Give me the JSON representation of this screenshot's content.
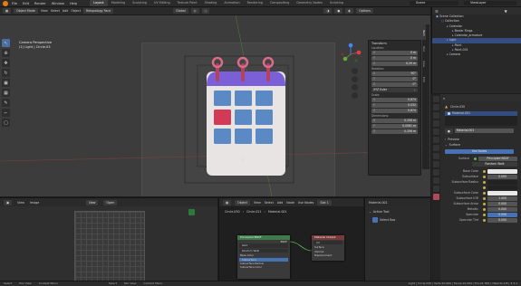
{
  "topbar": {
    "menus": [
      "File",
      "Edit",
      "Render",
      "Window",
      "Help"
    ],
    "tabs": [
      "Layout",
      "Modeling",
      "Sculpting",
      "UV Editing",
      "Texture Paint",
      "Shading",
      "Animation",
      "Rendering",
      "Compositing",
      "Geometry Nodes",
      "Scripting"
    ],
    "active_tab": "Layout",
    "scene": "Scene",
    "view_layer": "ViewLayer"
  },
  "viewport_header": {
    "mode": "Object Mode",
    "menus": [
      "View",
      "Select",
      "Add",
      "Object"
    ],
    "orientation": "Global",
    "transform_pivot": "Retopology Face",
    "options": "Options"
  },
  "viewport_info": {
    "line1": "Camera Perspective",
    "line2": "(1) Light | Circle.03"
  },
  "npanel": {
    "title": "Transform",
    "location_label": "Location:",
    "location": [
      {
        "axis": "X",
        "value": "0 m"
      },
      {
        "axis": "Y",
        "value": "0 m"
      },
      {
        "axis": "Z",
        "value": "0.29 m"
      }
    ],
    "rotation_label": "Rotation:",
    "rotation": [
      {
        "axis": "X",
        "value": "90°"
      },
      {
        "axis": "Y",
        "value": "0°"
      },
      {
        "axis": "Z",
        "value": "0°"
      }
    ],
    "mode": "XYZ Euler",
    "scale_label": "Scale:",
    "scale": [
      {
        "axis": "X",
        "value": "0.874"
      },
      {
        "axis": "Y",
        "value": "0.032"
      },
      {
        "axis": "Z",
        "value": "0.874"
      }
    ],
    "dimensions_label": "Dimensions:",
    "dimensions": [
      {
        "axis": "X",
        "value": "0.256 m"
      },
      {
        "axis": "Y",
        "value": "0.0061 m"
      },
      {
        "axis": "Z",
        "value": "0.256 m"
      }
    ],
    "tabs": [
      "Item",
      "Tool",
      "View",
      "Edit"
    ]
  },
  "outliner": {
    "items": [
      {
        "label": "Scene Collection",
        "indent": 0
      },
      {
        "label": "Collection",
        "indent": 1
      },
      {
        "label": "Calendar",
        "indent": 2
      },
      {
        "label": "Bezier Rings",
        "indent": 3
      },
      {
        "label": "Calendar_armature",
        "indent": 3
      },
      {
        "label": "Light",
        "indent": 2
      },
      {
        "label": "Point",
        "indent": 3
      },
      {
        "label": "Point.001",
        "indent": 3
      },
      {
        "label": "Camera",
        "indent": 2
      }
    ],
    "selected_index": 5
  },
  "properties": {
    "object": "Circle.030",
    "material_slot": "Material.001",
    "material": "Material.001",
    "preview_label": "Preview",
    "surface_label": "Surface",
    "use_nodes": "Use Nodes",
    "surface_field": "Surface",
    "surface_value": "Principled BSDF",
    "method": "Random Walk",
    "rows": [
      {
        "label": "Base Color",
        "value": "",
        "kind": "color"
      },
      {
        "label": "Subsurface",
        "value": "0.000",
        "kind": "num"
      },
      {
        "label": "Subsurface Radius",
        "value": "",
        "kind": "dark"
      },
      {
        "label": "",
        "value": "",
        "kind": "dark"
      },
      {
        "label": "Subsurface Color",
        "value": "",
        "kind": "white"
      },
      {
        "label": "Subsurface IOR",
        "value": "1.400",
        "kind": "num"
      },
      {
        "label": "Subsurface Aniso",
        "value": "0.000",
        "kind": "num"
      },
      {
        "label": "Metallic",
        "value": "0.000",
        "kind": "num"
      },
      {
        "label": "Specular",
        "value": "0.500",
        "kind": "blue"
      },
      {
        "label": "Specular Tint",
        "value": "0.000",
        "kind": "num"
      }
    ]
  },
  "image_editor": {
    "menus": [
      "View",
      "Image"
    ],
    "new_label": "New",
    "open_label": "Open"
  },
  "node_editor": {
    "mode": "Object",
    "menus": [
      "View",
      "Select",
      "Add",
      "Node"
    ],
    "use_nodes": "Use Nodes",
    "slot": "Slot 1",
    "material": "Material.001",
    "breadcrumb": [
      "Circle.030",
      "Circle.021",
      "Material.001"
    ],
    "node1_title": "Principled BSDF",
    "node1_rows": [
      "BSDF",
      "GGX",
      "Random Walk",
      "Base Color",
      "Subsurface",
      "Subsurface Radius",
      "Subsurface Color"
    ],
    "node2_title": "Material Output",
    "node2_rows": [
      "All",
      "Surface",
      "Volume",
      "Displacement"
    ]
  },
  "node_side": {
    "material": "Material.001",
    "active_tool": "Active Tool",
    "select_box": "Select Box"
  },
  "status": {
    "left": [
      "Select",
      "Pan View",
      "Context Menu"
    ],
    "mid": [
      "Select",
      "Pan View",
      "Context Menu"
    ],
    "right": "Light | Circle.030 | Verts:10,960 | Faces:10,264 | Tris:21,382 | Objects:1/8 | 3.3.1"
  },
  "colors": {
    "calendar_purple": "#7b5fd6",
    "calendar_pink_ring": "#d96b8c",
    "calendar_grid": "#5b89c4",
    "calendar_red": "#d23b58",
    "accent_blue": "#4772b3"
  }
}
